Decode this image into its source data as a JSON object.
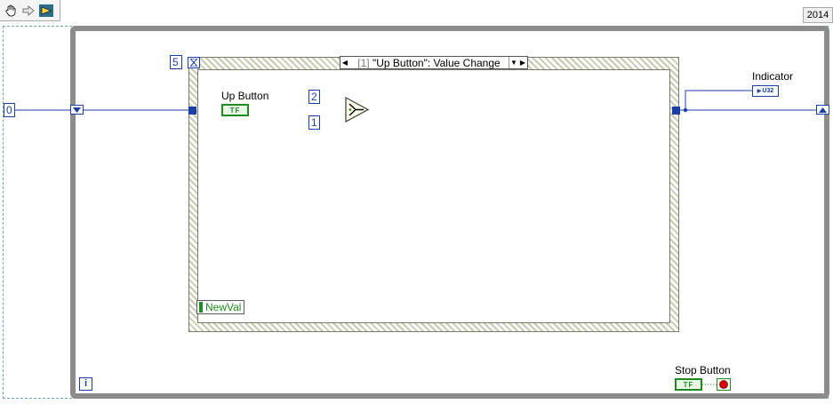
{
  "toolbar": {
    "hand_icon": "hand-icon",
    "arrow_icon": "arrow-right-icon",
    "run_icon": "run-icon"
  },
  "version": "2014",
  "diagram": {
    "init_const": "0",
    "timeout_const": "5",
    "const_two": "2",
    "const_one": "1",
    "up_button_label": "Up Button",
    "indicator_label": "Indicator",
    "indicator_type": "U32",
    "stop_button_label": "Stop Button",
    "bool_tf": "TF",
    "newval_label": "NewVal",
    "iteration_label": "i",
    "event_case": {
      "index": "[1]",
      "name": "\"Up Button\": Value Change"
    }
  },
  "colors": {
    "wire_numeric": "#1a3ea8",
    "wire_boolean": "#1f8a1f",
    "loop_border": "#8c8c8c",
    "event_hatch": "#c9c9b0"
  }
}
